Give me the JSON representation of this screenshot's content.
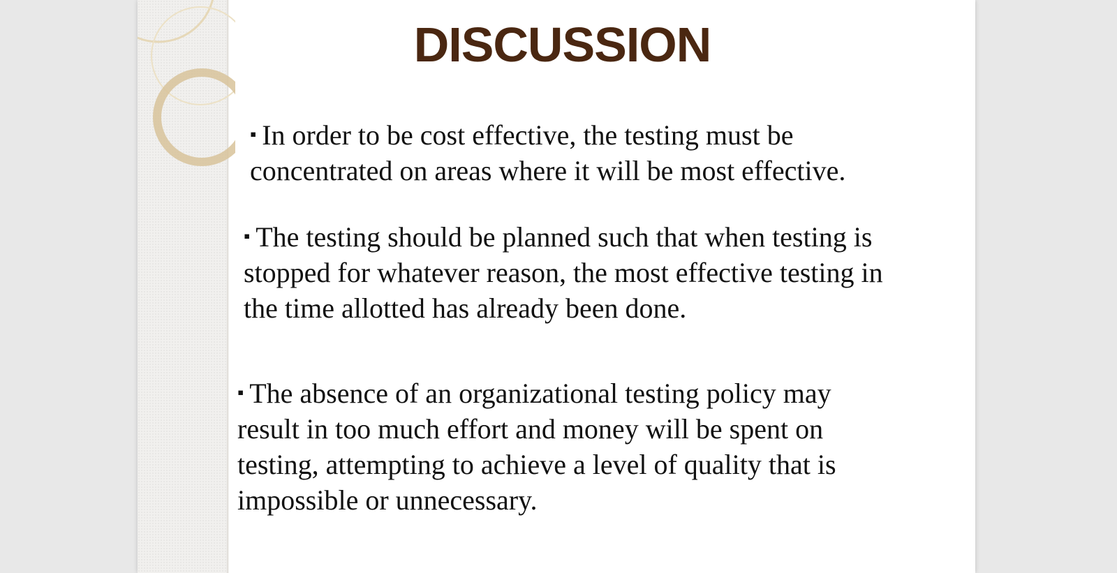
{
  "slide": {
    "title": "DISCUSSION",
    "bullet_marker": "▪",
    "bullets": [
      {
        "line1": "In order to be cost effective, the testing must be",
        "line2": "concentrated on areas where it will be most effective."
      },
      {
        "line1": "The testing should be planned such that when testing is",
        "line2": "stopped for whatever reason, the most effective testing in",
        "line3": "the time allotted has already been done."
      },
      {
        "line1": "The absence of an organizational testing policy may",
        "line2": "result in too much effort and money will be spent on",
        "line3": "testing, attempting to achieve a level of quality that is",
        "line4": "impossible or unnecessary."
      }
    ]
  },
  "colors": {
    "title": "#4a2711",
    "text": "#111111",
    "ring": "#d8c39a",
    "background": "#e8e8e8"
  }
}
